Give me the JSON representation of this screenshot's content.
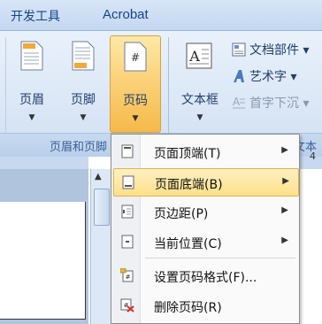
{
  "tabs": [
    "开发工具",
    "Acrobat"
  ],
  "header_footer_group": {
    "buttons": [
      {
        "label": "页眉"
      },
      {
        "label": "页脚"
      },
      {
        "label": "页码",
        "active": true
      }
    ],
    "group_label": "页眉和页脚"
  },
  "text_group": {
    "text_box_label": "文本框",
    "doc_parts_label": "文档部件 ▾",
    "wordart_label": "艺术字 ▾",
    "dropcap_label": "首字下沉 ▾",
    "group_label": "文本"
  },
  "page_number_menu": {
    "items": [
      {
        "label": "页面顶端(T)",
        "submenu": true
      },
      {
        "label": "页面底端(B)",
        "submenu": true,
        "highlighted": true
      },
      {
        "label": "页边距(P)",
        "submenu": true
      },
      {
        "label": "当前位置(C)",
        "submenu": true
      },
      {
        "label": "设置页码格式(F)...",
        "submenu": false
      },
      {
        "label": "删除页码(R)",
        "submenu": false
      }
    ]
  },
  "ruler_number": "4",
  "colors": {
    "ribbon_bg": "#dbe7f6",
    "active_button": "#fbd27a",
    "menu_highlight": "#fde08a",
    "text_blue": "#1f3d6e"
  }
}
